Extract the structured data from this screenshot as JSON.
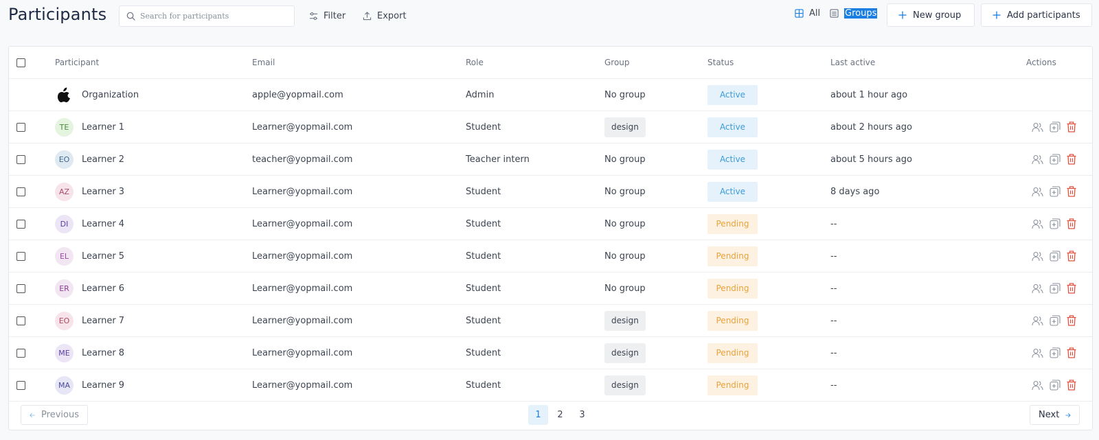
{
  "header": {
    "title": "Participants",
    "search_placeholder": "Search for participants",
    "filter_label": "Filter",
    "export_label": "Export",
    "view_all_label": "All",
    "view_groups_label": "Groups",
    "new_group_label": "New group",
    "add_participants_label": "Add participants"
  },
  "table": {
    "columns": {
      "participant": "Participant",
      "email": "Email",
      "role": "Role",
      "group": "Group",
      "status": "Status",
      "last_active": "Last active",
      "actions": "Actions"
    },
    "rows": [
      {
        "initials": "",
        "name": "Organization",
        "email": "apple@yopmail.com",
        "role": "Admin",
        "group": "No group",
        "status": "Active",
        "last_active": "about 1 hour ago",
        "avatar_type": "apple-logo"
      },
      {
        "initials": "TE",
        "name": "Learner 1",
        "email": "Learner@yopmail.com",
        "role": "Student",
        "group": "design",
        "status": "Active",
        "last_active": "about 2 hours ago",
        "avatar_bg": "#e4f4df",
        "avatar_fg": "#4a8a3c"
      },
      {
        "initials": "EO",
        "name": "Learner 2",
        "email": "teacher@yopmail.com",
        "role": "Teacher intern",
        "group": "No group",
        "status": "Active",
        "last_active": "about 5 hours ago",
        "avatar_bg": "#dfe9f2",
        "avatar_fg": "#3e6a8f"
      },
      {
        "initials": "AZ",
        "name": "Learner 3",
        "email": "Learner@yopmail.com",
        "role": "Student",
        "group": "No group",
        "status": "Active",
        "last_active": "8 days ago",
        "avatar_bg": "#f6e4ea",
        "avatar_fg": "#b04a6a"
      },
      {
        "initials": "DI",
        "name": "Learner 4",
        "email": "Learner@yopmail.com",
        "role": "Student",
        "group": "No group",
        "status": "Pending",
        "last_active": "--",
        "avatar_bg": "#ece5f6",
        "avatar_fg": "#5a3ea0"
      },
      {
        "initials": "EL",
        "name": "Learner 5",
        "email": "Learner@yopmail.com",
        "role": "Student",
        "group": "No group",
        "status": "Pending",
        "last_active": "--",
        "avatar_bg": "#f2e6f2",
        "avatar_fg": "#9a4aa0"
      },
      {
        "initials": "ER",
        "name": "Learner 6",
        "email": "Learner@yopmail.com",
        "role": "Student",
        "group": "No group",
        "status": "Pending",
        "last_active": "--",
        "avatar_bg": "#f2e6f2",
        "avatar_fg": "#8a3e8f"
      },
      {
        "initials": "EO",
        "name": "Learner 7",
        "email": "Learner@yopmail.com",
        "role": "Student",
        "group": "design",
        "status": "Pending",
        "last_active": "--",
        "avatar_bg": "#f6e4ea",
        "avatar_fg": "#b0485e"
      },
      {
        "initials": "ME",
        "name": "Learner 8",
        "email": "Learner@yopmail.com",
        "role": "Student",
        "group": "design",
        "status": "Pending",
        "last_active": "--",
        "avatar_bg": "#ece5f6",
        "avatar_fg": "#5a3ea0"
      },
      {
        "initials": "MA",
        "name": "Learner 9",
        "email": "Learner@yopmail.com",
        "role": "Student",
        "group": "design",
        "status": "Pending",
        "last_active": "--",
        "avatar_bg": "#e6e6f6",
        "avatar_fg": "#4a4a9a"
      }
    ]
  },
  "pagination": {
    "previous_label": "Previous",
    "next_label": "Next",
    "pages": [
      "1",
      "2",
      "3"
    ],
    "current_page": "1"
  },
  "colors": {
    "accent": "#1a7fe0",
    "active_bg": "#e6f2fb",
    "active_fg": "#3a9ad9",
    "pending_bg": "#fdf1e2",
    "pending_fg": "#e9a23b",
    "delete_icon": "#e0523f",
    "action_icon": "#8a919c"
  },
  "icons": {
    "search": "search-icon",
    "filter": "sliders-icon",
    "export": "upload-icon",
    "all_view": "grid-icon",
    "groups_view": "list-icon",
    "add": "plus-icon",
    "participants": "users-icon",
    "add_to_group": "copy-plus-icon",
    "delete": "trash-icon",
    "org_logo": "apple-logo-icon"
  }
}
